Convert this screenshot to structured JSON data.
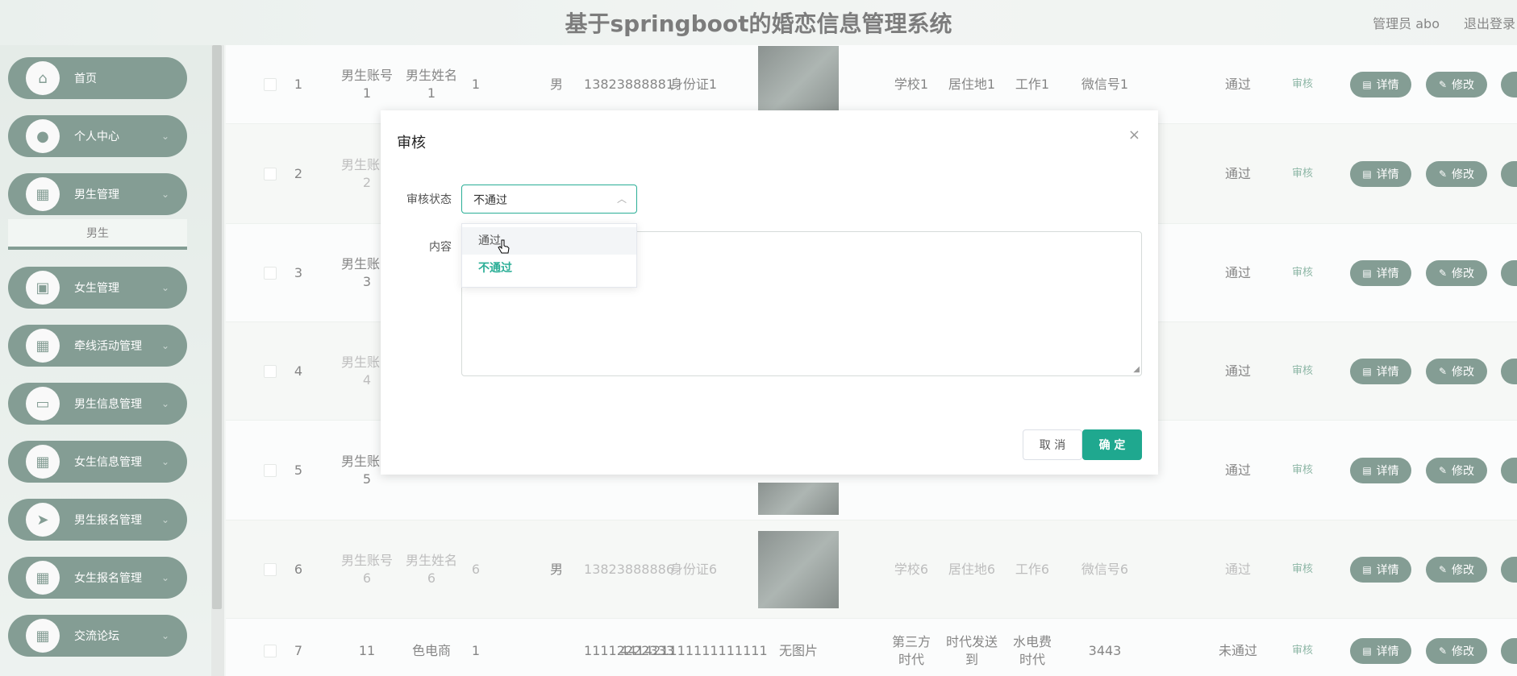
{
  "header": {
    "title": "基于springboot的婚恋信息管理系统",
    "user": "管理员 abo",
    "logout": "退出登录"
  },
  "sidebar": {
    "items": [
      {
        "label": "首页",
        "icon": "home-icon"
      },
      {
        "label": "个人中心",
        "icon": "user-icon"
      },
      {
        "label": "男生管理",
        "icon": "grid-icon"
      },
      {
        "label": "女生管理",
        "icon": "badge-icon"
      },
      {
        "label": "牵线活动管理",
        "icon": "grid-icon"
      },
      {
        "label": "男生信息管理",
        "icon": "briefcase-icon"
      },
      {
        "label": "女生信息管理",
        "icon": "grid-icon"
      },
      {
        "label": "男生报名管理",
        "icon": "send-icon"
      },
      {
        "label": "女生报名管理",
        "icon": "grid-icon"
      },
      {
        "label": "交流论坛",
        "icon": "grid-icon"
      }
    ],
    "sub_item": "男生"
  },
  "table": {
    "rows": [
      {
        "no": "1",
        "account": "男生账号1",
        "name": "男生姓名1",
        "age": "1",
        "sex": "男",
        "phone": "13823888881",
        "id": "身份证1",
        "photo": "",
        "school": "学校1",
        "addr": "居住地1",
        "work": "工作1",
        "wechat": "微信号1",
        "status": "通过"
      },
      {
        "no": "2",
        "account": "男生账号2",
        "name": "",
        "age": "",
        "sex": "",
        "phone": "",
        "id": "",
        "photo": "",
        "school": "",
        "addr": "",
        "work": "",
        "wechat": "",
        "status": "通过"
      },
      {
        "no": "3",
        "account": "男生账号3",
        "name": "",
        "age": "",
        "sex": "",
        "phone": "",
        "id": "",
        "photo": "",
        "school": "",
        "addr": "",
        "work": "",
        "wechat": "",
        "status": "通过"
      },
      {
        "no": "4",
        "account": "男生账号4",
        "name": "",
        "age": "",
        "sex": "",
        "phone": "",
        "id": "",
        "photo": "",
        "school": "",
        "addr": "",
        "work": "",
        "wechat": "",
        "status": "通过"
      },
      {
        "no": "5",
        "account": "男生账号5",
        "name": "",
        "age": "",
        "sex": "",
        "phone": "",
        "id": "",
        "photo": "",
        "school": "",
        "addr": "",
        "work": "",
        "wechat": "",
        "status": "通过"
      },
      {
        "no": "6",
        "account": "男生账号6",
        "name": "男生姓名6",
        "age": "6",
        "sex": "男",
        "phone": "13823888886",
        "id": "身份证6",
        "photo": "",
        "school": "学校6",
        "addr": "居住地6",
        "work": "工作6",
        "wechat": "微信号6",
        "status": "通过"
      },
      {
        "no": "7",
        "account": "11",
        "name": "色电商",
        "age": "1",
        "sex": "",
        "phone": "11112222333",
        "id": "441421111111111111",
        "photo": "无图片",
        "school": "第三方时代",
        "addr": "时代发送到",
        "work": "水电费时代",
        "wechat": "3443",
        "status": "未通过"
      }
    ],
    "audit": "审核",
    "detail": "详情",
    "edit": "修改"
  },
  "modal": {
    "title": "审核",
    "status_label": "审核状态",
    "content_label": "内容",
    "selected": "不通过",
    "options": [
      "通过",
      "不通过"
    ],
    "cancel": "取 消",
    "ok": "确 定"
  },
  "colors": {
    "primary": "#1f4d3d",
    "accent": "#1fa88f"
  }
}
